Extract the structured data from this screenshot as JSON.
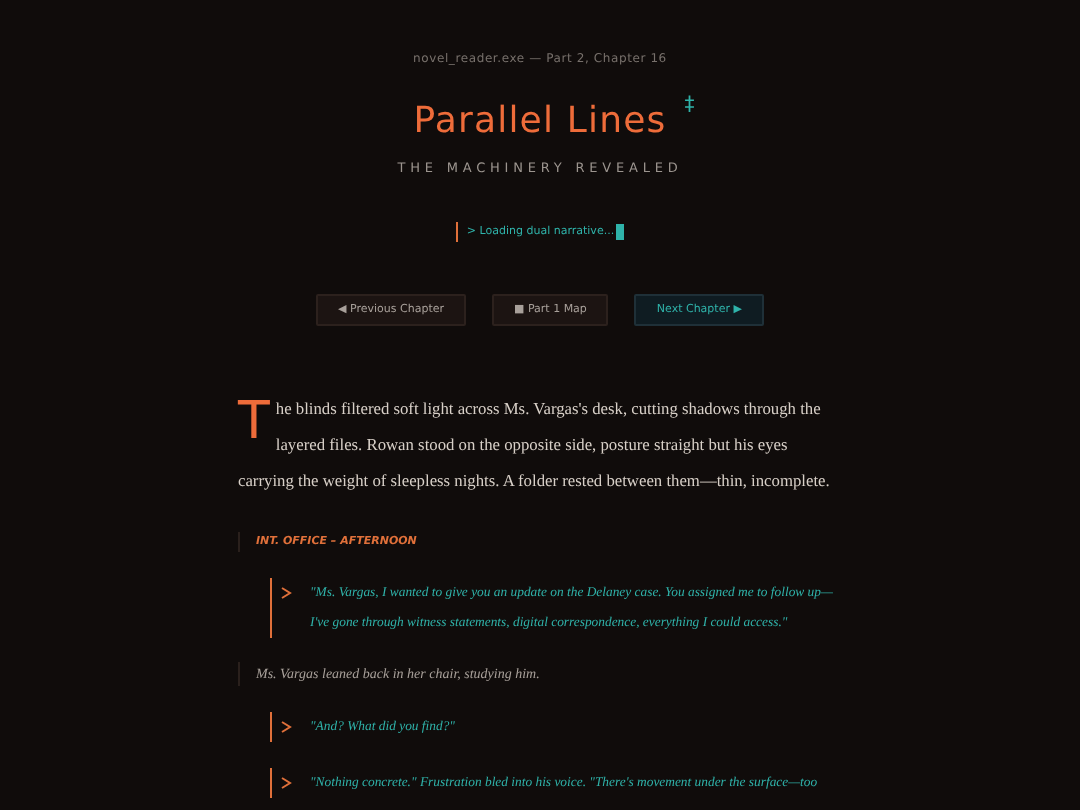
{
  "header": {
    "path": "novel_reader.exe — Part 2, Chapter 16",
    "title": "Parallel Lines",
    "title_mark": "‡",
    "subtitle": "THE MACHINERY REVEALED",
    "loading": "> Loading dual narrative..."
  },
  "nav": [
    {
      "label": "◀ Previous Chapter",
      "primary": false
    },
    {
      "label": "■ Part 1 Map",
      "primary": false
    },
    {
      "label": "Next Chapter ▶",
      "primary": true
    }
  ],
  "story": [
    {
      "kind": "opening",
      "drop_cap": "T",
      "text": "he blinds filtered soft light across Ms. Vargas's desk, cutting shadows through the layered files. Rowan stood on the opposite side, posture straight but his eyes carrying the weight of sleepless nights. A folder rested between them—thin, incomplete."
    },
    {
      "kind": "scene",
      "text": "INT. OFFICE – AFTERNOON"
    },
    {
      "kind": "dialogue",
      "text": "\"Ms. Vargas, I wanted to give you an update on the Delaney case. You assigned me to follow up—I've gone through witness statements, digital correspondence, everything I could access.\""
    },
    {
      "kind": "narration",
      "text": "Ms. Vargas leaned back in her chair, studying him."
    },
    {
      "kind": "dialogue",
      "text": "\"And? What did you find?\""
    },
    {
      "kind": "dialogue",
      "text": "\"Nothing concrete.\" Frustration bled into his voice. \"There's movement under the surface—too"
    }
  ]
}
